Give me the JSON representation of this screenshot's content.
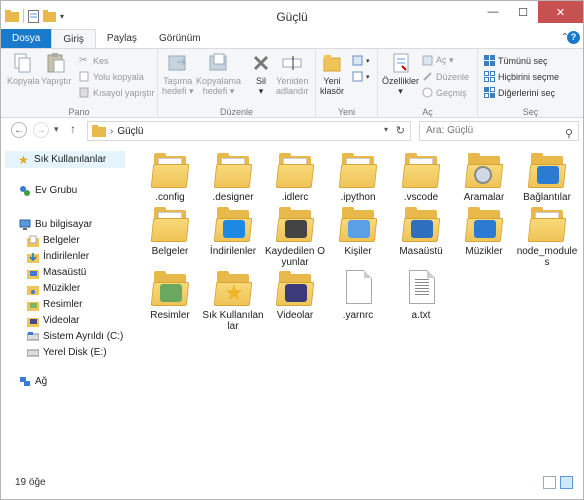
{
  "window": {
    "title": "Güçlü"
  },
  "window_buttons": {
    "minimize": "—",
    "maximize": "☐",
    "close": "✕"
  },
  "ribbon_tabs": [
    "Dosya",
    "Giriş",
    "Paylaş",
    "Görünüm"
  ],
  "ribbon": {
    "pano": {
      "label": "Pano",
      "kopyala": "Kopyala",
      "yapistir": "Yapıştır",
      "kes": "Kes",
      "yolu_kopyala": "Yolu kopyala",
      "kisayol_yapistir": "Kısayol yapıştır"
    },
    "duzenle": {
      "label": "Düzenle",
      "tasima_hedefi_1": "Taşıma",
      "tasima_hedefi_2": "hedefi ▾",
      "kopyalama_hedefi_1": "Kopyalama",
      "kopyalama_hedefi_2": "hedefi ▾",
      "sil_1": "Sil",
      "sil_2": "▾",
      "yeniden_adlandir_1": "Yeniden",
      "yeniden_adlandir_2": "adlandır"
    },
    "yeni": {
      "label": "Yeni",
      "yeni_klasor_1": "Yeni",
      "yeni_klasor_2": "klasör"
    },
    "ac": {
      "label": "Aç",
      "ozellikler_1": "Özellikler",
      "ozellikler_2": "▾",
      "ac": "Aç ▾",
      "duzenle": "Düzenle",
      "gecmis": "Geçmiş"
    },
    "sec": {
      "label": "Seç",
      "tumunu_sec": "Tümünü seç",
      "hicbirini_secme": "Hiçbirini seçme",
      "digerlerini_sec": "Diğerlerini seç"
    }
  },
  "navigation": {
    "back": "←",
    "forward": "→",
    "recent": "▾",
    "up": "↑",
    "address_path": "Güçlü",
    "address_sep": "›",
    "refresh": "↻",
    "search_placeholder": "Ara: Güçlü",
    "search_glyph": "⚲"
  },
  "nav_pane": {
    "favorites": "Sık Kullanılanlar",
    "homegroup": "Ev Grubu",
    "this_pc": "Bu bilgisayar",
    "pc_items": [
      "Belgeler",
      "İndirilenler",
      "Masaüstü",
      "Müzikler",
      "Resimler",
      "Videolar",
      "Sistem Ayrıldı (C:)",
      "Yerel Disk (E:)"
    ],
    "network": "Ağ"
  },
  "items": [
    {
      "name": ".config",
      "kind": "folder-docs"
    },
    {
      "name": ".designer",
      "kind": "folder-docs"
    },
    {
      "name": ".idlerc",
      "kind": "folder-docs"
    },
    {
      "name": ".ipython",
      "kind": "folder-docs"
    },
    {
      "name": ".vscode",
      "kind": "folder-docs"
    },
    {
      "name": "Aramalar",
      "kind": "folder-search"
    },
    {
      "name": "Bağlantılar",
      "kind": "folder-links"
    },
    {
      "name": "Belgeler",
      "kind": "folder-documents"
    },
    {
      "name": "İndirilenler",
      "kind": "folder-downloads"
    },
    {
      "name": "Kaydedilen Oyunlar",
      "kind": "folder-games"
    },
    {
      "name": "Kişiler",
      "kind": "folder-contacts"
    },
    {
      "name": "Masaüstü",
      "kind": "folder-desktop"
    },
    {
      "name": "Müzikler",
      "kind": "folder-music"
    },
    {
      "name": "node_modules",
      "kind": "folder-plain"
    },
    {
      "name": "Resimler",
      "kind": "folder-pictures"
    },
    {
      "name": "Sık Kullanılanlar",
      "kind": "folder-favorites"
    },
    {
      "name": "Videolar",
      "kind": "folder-videos"
    },
    {
      "name": ".yarnrc",
      "kind": "file"
    },
    {
      "name": "a.txt",
      "kind": "file-txt"
    }
  ],
  "status": {
    "count": "19 öğe"
  },
  "colors": {
    "accent": "#1979ca",
    "folder": "#efc458",
    "selected": "#e5f3fb"
  }
}
